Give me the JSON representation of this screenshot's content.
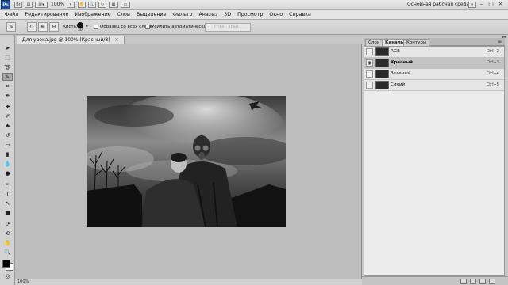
{
  "app": {
    "logo": "Ps",
    "zoom": "100%",
    "workspace": "Основная рабочая среда",
    "window_controls": [
      "–",
      "□",
      "×"
    ]
  },
  "menu": [
    "Файл",
    "Редактирование",
    "Изображение",
    "Слои",
    "Выделение",
    "Фильтр",
    "Анализ",
    "3D",
    "Просмотр",
    "Окно",
    "Справка"
  ],
  "options": {
    "brush_label": "Кисть:",
    "brush_size": "30",
    "sample_all_label": "Образец со всех слоев",
    "auto_enhance_label": "Усилить автоматически",
    "refine_edge": "Уточн. край..."
  },
  "document": {
    "tab_title": "Для урока.jpg @ 100% (Красный/8)",
    "close": "×",
    "status_zoom": "100%"
  },
  "panel": {
    "tabs": [
      "Слои",
      "Каналы",
      "Контуры"
    ],
    "active_tab": 1,
    "channels": [
      {
        "name": "RGB",
        "shortcut": "Ctrl+2",
        "visible": false,
        "selected": false
      },
      {
        "name": "Красный",
        "shortcut": "Ctrl+3",
        "visible": true,
        "selected": true
      },
      {
        "name": "Зеленый",
        "shortcut": "Ctrl+4",
        "visible": false,
        "selected": false
      },
      {
        "name": "Синий",
        "shortcut": "Ctrl+5",
        "visible": false,
        "selected": false
      }
    ]
  },
  "colors": {
    "foreground": "#000000",
    "background": "#ffffff",
    "logo_bg": "#1f4c8f"
  }
}
